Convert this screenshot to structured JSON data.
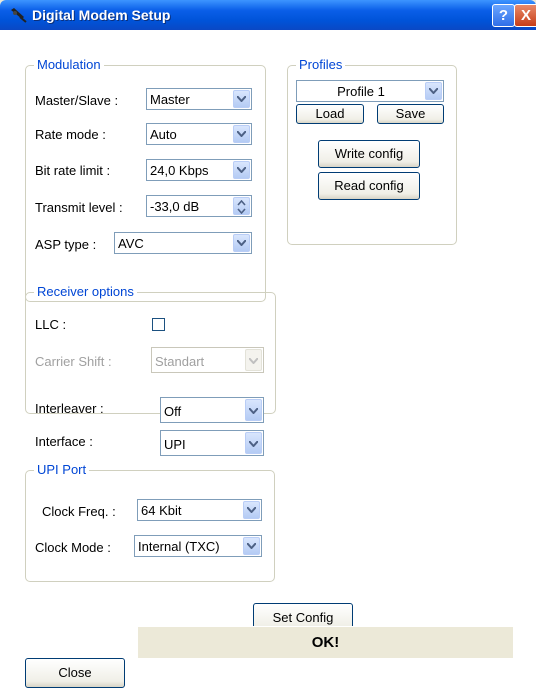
{
  "window": {
    "title": "Digital Modem Setup",
    "help_label": "?",
    "close_label": "X"
  },
  "modulation": {
    "legend": "Modulation",
    "master_slave": {
      "label": "Master/Slave :",
      "value": "Master"
    },
    "rate_mode": {
      "label": "Rate mode :",
      "value": "Auto"
    },
    "bit_rate_limit": {
      "label": "Bit rate limit :",
      "value": "24,0 Kbps"
    },
    "transmit_level": {
      "label": "Transmit level :",
      "value": "-33,0 dB"
    },
    "asp_type": {
      "label": "ASP type :",
      "value": "AVC"
    }
  },
  "profiles": {
    "legend": "Profiles",
    "selected": "Profile 1",
    "load_label": "Load",
    "save_label": "Save",
    "write_config_label": "Write config",
    "read_config_label": "Read config"
  },
  "receiver_options": {
    "legend": "Receiver options",
    "llc": {
      "label": "LLC :",
      "checked": false
    },
    "carrier_shift": {
      "label": "Carrier Shift :",
      "value": "Standart"
    }
  },
  "interleaver": {
    "label": "Interleaver :",
    "value": "Off"
  },
  "interface": {
    "label": "Interface :",
    "value": "UPI"
  },
  "upi_port": {
    "legend": "UPI Port",
    "clock_freq": {
      "label": "Clock Freq. :",
      "value": "64 Kbit"
    },
    "clock_mode": {
      "label": "Clock Mode :",
      "value": "Internal (TXC)"
    }
  },
  "set_config_label": "Set Config",
  "close_label": "Close",
  "status_text": "OK!",
  "colors": {
    "titlebar": "#0053d8",
    "legend": "#0046d5",
    "dialog_bg": "#ece9d8"
  },
  "icons": {
    "app": "satellite-dish-icon",
    "dropdown": "chevron-down-icon"
  }
}
